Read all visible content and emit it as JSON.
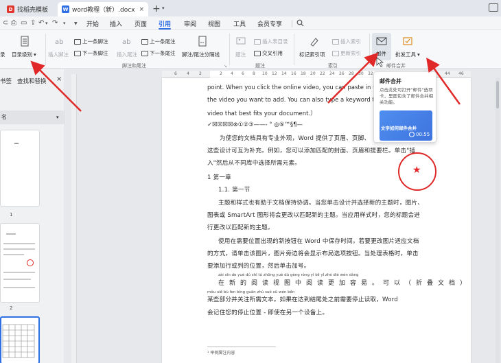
{
  "tabs": [
    {
      "label": "找稻壳模板",
      "icon": "D"
    },
    {
      "label": "word教程（新）.docx",
      "icon": "W",
      "close": "×"
    }
  ],
  "new_tab": "+",
  "menu": [
    "开始",
    "插入",
    "页面",
    "引用",
    "审阅",
    "视图",
    "工具",
    "会员专享"
  ],
  "active_menu": "引用",
  "ribbon": {
    "toc_level": "目录级别",
    "toc_partial": "录",
    "insert_footnote": "插入脚注",
    "prev_footnote": "上一条脚注",
    "next_footnote": "下一条脚注",
    "insert_endnote": "插入尾注",
    "prev_endnote": "上一条尾注",
    "next_endnote": "下一条尾注",
    "footnote_sep": "脚注/尾注分隔线",
    "caption": "题注",
    "insert_table_figure": "插入表目录",
    "cross_ref": "交叉引用",
    "mark_index": "标记索引项",
    "insert_index": "插入索引",
    "update_index": "更新索引",
    "mail": "邮件",
    "bulk_tools": "批发工具",
    "group_partial_toc": "录",
    "group_footnote": "脚注和尾注",
    "group_caption": "题注",
    "group_index": "索引",
    "group_mail": "邮件合并"
  },
  "left_panel": {
    "tab1": "书签",
    "tab2": "查找和替换",
    "close": "×",
    "section_header": "名",
    "page_numbers": [
      "1",
      "2"
    ]
  },
  "ruler_ticks": [
    "6",
    "4",
    "2",
    "2",
    "4",
    "6",
    "8",
    "10",
    "12",
    "14",
    "16",
    "18",
    "20",
    "22",
    "24",
    "26",
    "28",
    "30",
    "32",
    "34",
    "36",
    "38",
    "40",
    "44",
    "46"
  ],
  "document": {
    "line1": "point. When you click the online video, you can paste in the e",
    "line2": "the video you want to add. You can also type a keyword to s",
    "line3": "video that best fits your document.）",
    "symbols": "✓☒☒☒☒⊗①②③——-   °  ◎⑥™§¶—",
    "para1a": "为使您的文档具有专业外观，Word 提供了页眉、页脚、",
    "para1b": "这些设计可互为补充。例如，您可以添加匹配的封面、页眉和提要栏。单击\"插",
    "para1c": "入\"然后从不同库中选择所需元素。",
    "heading1": "1    第一章",
    "heading2": "1.1. 第一节",
    "para2a": "主题和样式也有助于文档保持协调。当您单击设计并选择新的主题时，图片、",
    "para2b": "图表或 SmartArt 图形将会更改以匹配新的主题。当应用样式时，您的标题会进",
    "para2c": "行更改以匹配新的主题。",
    "para3a": "使用在需要位置出现的新按钮在 Word 中保存时间。若要更改图片适应文档",
    "para3b": "的方式，请单击该图片，图片旁边将会显示布局选项按钮。当处理表格时，单击",
    "para3c": "要添加行或列的位置，然后单击加号。",
    "pinyin1": "zài xīn de yuè dú shì tú zhōng yuè dú gèng róng yì    kě yǐ    zhé dié wén dàng",
    "line_spaced": "在新的阅读视图中阅读更加容易。可以（折叠文档）",
    "pinyin2": "mǒu xiē bù fen bìng guān zhù suǒ xū wén běn",
    "para4a": "某些部分并关注所需文本。如果在达到结尾处之前需要停止读取，Word",
    "para4b": "会记住您的停止位置 - 即使在另一个设备上。",
    "footnote": "¹ 举例脚注内容"
  },
  "tooltip": {
    "title": "邮件合并",
    "body": "点击此处可打开\"邮件\"选项卡，里面包含了邮件合并相关功能。",
    "video_label": "文字如何邮件合并",
    "duration": "00:55"
  },
  "colors": {
    "accent": "#2f6fe4",
    "arrow": "#e02828",
    "stamp": "#e02828"
  }
}
